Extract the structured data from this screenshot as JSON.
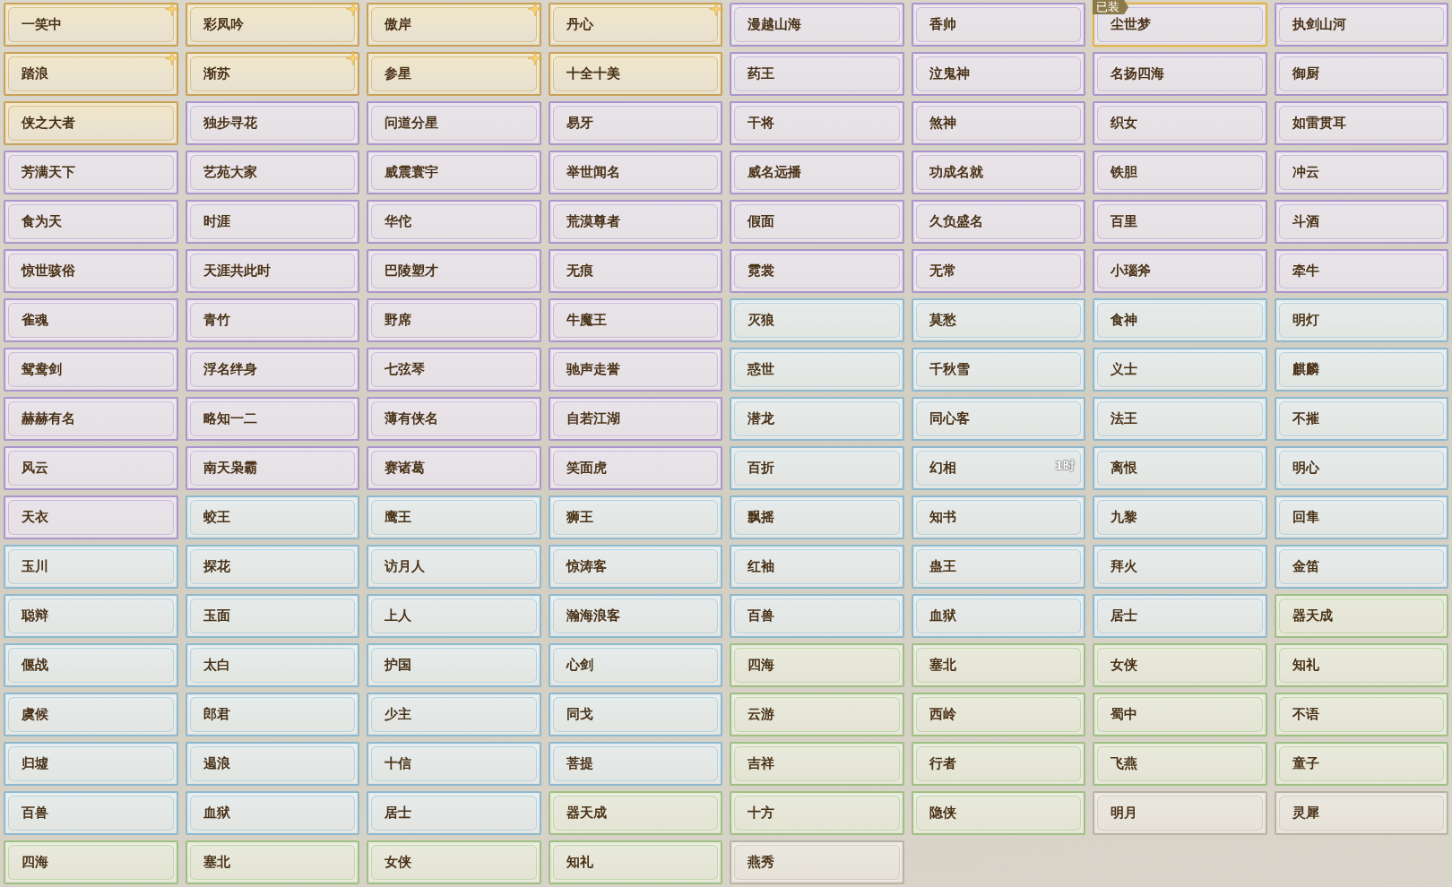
{
  "titles": [
    {
      "name": "一笑中",
      "kind": "gold",
      "starred": true,
      "equipped": false
    },
    {
      "name": "彩凤吟",
      "kind": "gold",
      "starred": true,
      "equipped": false
    },
    {
      "name": "傲岸",
      "kind": "gold",
      "starred": true,
      "equipped": false
    },
    {
      "name": "丹心",
      "kind": "gold",
      "starred": true,
      "equipped": false
    },
    {
      "name": "漫越山海",
      "kind": "purple",
      "starred": false,
      "equipped": false
    },
    {
      "name": "香帅",
      "kind": "purple",
      "starred": false,
      "equipped": false
    },
    {
      "name": "尘世梦",
      "kind": "purple",
      "starred": false,
      "equipped": true,
      "badge": "已装"
    },
    {
      "name": "执剑山河",
      "kind": "purple",
      "starred": false,
      "equipped": false
    },
    {
      "name": "踏浪",
      "kind": "gold",
      "starred": true,
      "equipped": false
    },
    {
      "name": "渐苏",
      "kind": "gold",
      "starred": true,
      "equipped": false
    },
    {
      "name": "参星",
      "kind": "gold",
      "starred": true,
      "equipped": false
    },
    {
      "name": "十全十美",
      "kind": "gold",
      "starred": false,
      "equipped": false
    },
    {
      "name": "药王",
      "kind": "purple",
      "starred": false,
      "equipped": false
    },
    {
      "name": "泣鬼神",
      "kind": "purple",
      "starred": false,
      "equipped": false
    },
    {
      "name": "名扬四海",
      "kind": "purple",
      "starred": false,
      "equipped": false
    },
    {
      "name": "御厨",
      "kind": "purple",
      "starred": false,
      "equipped": false
    },
    {
      "name": "侠之大者",
      "kind": "gold",
      "starred": false,
      "equipped": false
    },
    {
      "name": "独步寻花",
      "kind": "purple",
      "starred": false,
      "equipped": false
    },
    {
      "name": "问道分星",
      "kind": "purple",
      "starred": false,
      "equipped": false
    },
    {
      "name": "易牙",
      "kind": "purple",
      "starred": false,
      "equipped": false
    },
    {
      "name": "干将",
      "kind": "purple",
      "starred": false,
      "equipped": false
    },
    {
      "name": "煞神",
      "kind": "purple",
      "starred": false,
      "equipped": false
    },
    {
      "name": "织女",
      "kind": "purple",
      "starred": false,
      "equipped": false
    },
    {
      "name": "如雷贯耳",
      "kind": "purple",
      "starred": false,
      "equipped": false
    },
    {
      "name": "芳满天下",
      "kind": "purple",
      "starred": false,
      "equipped": false
    },
    {
      "name": "艺苑大家",
      "kind": "purple",
      "starred": false,
      "equipped": false
    },
    {
      "name": "威震寰宇",
      "kind": "purple",
      "starred": false,
      "equipped": false
    },
    {
      "name": "举世闻名",
      "kind": "purple",
      "starred": false,
      "equipped": false
    },
    {
      "name": "威名远播",
      "kind": "purple",
      "starred": false,
      "equipped": false
    },
    {
      "name": "功成名就",
      "kind": "purple",
      "starred": false,
      "equipped": false
    },
    {
      "name": "铁胆",
      "kind": "purple",
      "starred": false,
      "equipped": false
    },
    {
      "name": "冲云",
      "kind": "purple",
      "starred": false,
      "equipped": false
    },
    {
      "name": "食为天",
      "kind": "purple",
      "starred": false,
      "equipped": false
    },
    {
      "name": "时涯",
      "kind": "purple",
      "starred": false,
      "equipped": false
    },
    {
      "name": "华佗",
      "kind": "purple",
      "starred": false,
      "equipped": false
    },
    {
      "name": "荒漠尊者",
      "kind": "purple",
      "starred": false,
      "equipped": false
    },
    {
      "name": "假面",
      "kind": "purple",
      "starred": false,
      "equipped": false
    },
    {
      "name": "久负盛名",
      "kind": "purple",
      "starred": false,
      "equipped": false
    },
    {
      "name": "百里",
      "kind": "purple",
      "starred": false,
      "equipped": false
    },
    {
      "name": "斗酒",
      "kind": "purple",
      "starred": false,
      "equipped": false
    },
    {
      "name": "惊世骇俗",
      "kind": "purple",
      "starred": false,
      "equipped": false
    },
    {
      "name": "天涯共此时",
      "kind": "purple",
      "starred": false,
      "equipped": false
    },
    {
      "name": "巴陵塑才",
      "kind": "purple",
      "starred": false,
      "equipped": false
    },
    {
      "name": "无痕",
      "kind": "purple",
      "starred": false,
      "equipped": false
    },
    {
      "name": "霓裳",
      "kind": "purple",
      "starred": false,
      "equipped": false
    },
    {
      "name": "无常",
      "kind": "purple",
      "starred": false,
      "equipped": false
    },
    {
      "name": "小瑙斧",
      "kind": "purple",
      "starred": false,
      "equipped": false
    },
    {
      "name": "牵牛",
      "kind": "purple",
      "starred": false,
      "equipped": false
    },
    {
      "name": "雀魂",
      "kind": "purple",
      "starred": false,
      "equipped": false
    },
    {
      "name": "青竹",
      "kind": "purple",
      "starred": false,
      "equipped": false
    },
    {
      "name": "野席",
      "kind": "purple",
      "starred": false,
      "equipped": false
    },
    {
      "name": "牛魔王",
      "kind": "purple",
      "starred": false,
      "equipped": false
    },
    {
      "name": "灭狼",
      "kind": "blue",
      "starred": false,
      "equipped": false
    },
    {
      "name": "莫愁",
      "kind": "blue",
      "starred": false,
      "equipped": false
    },
    {
      "name": "食神",
      "kind": "blue",
      "starred": false,
      "equipped": false
    },
    {
      "name": "明灯",
      "kind": "blue",
      "starred": false,
      "equipped": false
    },
    {
      "name": "鸳鸯剑",
      "kind": "purple",
      "starred": false,
      "equipped": false
    },
    {
      "name": "浮名绊身",
      "kind": "purple",
      "starred": false,
      "equipped": false
    },
    {
      "name": "七弦琴",
      "kind": "purple",
      "starred": false,
      "equipped": false
    },
    {
      "name": "驰声走誉",
      "kind": "purple",
      "starred": false,
      "equipped": false
    },
    {
      "name": "惑世",
      "kind": "blue",
      "starred": false,
      "equipped": false
    },
    {
      "name": "千秋雪",
      "kind": "blue",
      "starred": false,
      "equipped": false
    },
    {
      "name": "义士",
      "kind": "blue",
      "starred": false,
      "equipped": false
    },
    {
      "name": "麒麟",
      "kind": "blue",
      "starred": false,
      "equipped": false
    },
    {
      "name": "赫赫有名",
      "kind": "purple",
      "starred": false,
      "equipped": false
    },
    {
      "name": "略知一二",
      "kind": "purple",
      "starred": false,
      "equipped": false
    },
    {
      "name": "薄有侠名",
      "kind": "purple",
      "starred": false,
      "equipped": false
    },
    {
      "name": "自若江湖",
      "kind": "purple",
      "starred": false,
      "equipped": false
    },
    {
      "name": "潜龙",
      "kind": "blue",
      "starred": false,
      "equipped": false
    },
    {
      "name": "同心客",
      "kind": "blue",
      "starred": false,
      "equipped": false
    },
    {
      "name": "法王",
      "kind": "blue",
      "starred": false,
      "equipped": false
    },
    {
      "name": "不摧",
      "kind": "blue",
      "starred": false,
      "equipped": false
    },
    {
      "name": "风云",
      "kind": "purple",
      "starred": false,
      "equipped": false
    },
    {
      "name": "南天枭霸",
      "kind": "purple",
      "starred": false,
      "equipped": false
    },
    {
      "name": "赛诸葛",
      "kind": "purple",
      "starred": false,
      "equipped": false
    },
    {
      "name": "笑面虎",
      "kind": "purple",
      "starred": false,
      "equipped": false
    },
    {
      "name": "百折",
      "kind": "blue",
      "starred": false,
      "equipped": false
    },
    {
      "name": "幻相",
      "kind": "blue",
      "starred": false,
      "equipped": false,
      "timer": "1时"
    },
    {
      "name": "离恨",
      "kind": "blue",
      "starred": false,
      "equipped": false
    },
    {
      "name": "明心",
      "kind": "blue",
      "starred": false,
      "equipped": false
    },
    {
      "name": "天衣",
      "kind": "purple",
      "starred": false,
      "equipped": false
    },
    {
      "name": "蛟王",
      "kind": "blue",
      "starred": false,
      "equipped": false
    },
    {
      "name": "鹰王",
      "kind": "blue",
      "starred": false,
      "equipped": false
    },
    {
      "name": "狮王",
      "kind": "blue",
      "starred": false,
      "equipped": false
    },
    {
      "name": "飘摇",
      "kind": "blue",
      "starred": false,
      "equipped": false
    },
    {
      "name": "知书",
      "kind": "blue",
      "starred": false,
      "equipped": false
    },
    {
      "name": "九黎",
      "kind": "blue",
      "starred": false,
      "equipped": false
    },
    {
      "name": "回隼",
      "kind": "blue",
      "starred": false,
      "equipped": false
    },
    {
      "name": "玉川",
      "kind": "blue",
      "starred": false,
      "equipped": false
    },
    {
      "name": "探花",
      "kind": "blue",
      "starred": false,
      "equipped": false
    },
    {
      "name": "访月人",
      "kind": "blue",
      "starred": false,
      "equipped": false
    },
    {
      "name": "惊涛客",
      "kind": "blue",
      "starred": false,
      "equipped": false
    },
    {
      "name": "红袖",
      "kind": "blue",
      "starred": false,
      "equipped": false
    },
    {
      "name": "蛊王",
      "kind": "blue",
      "starred": false,
      "equipped": false
    },
    {
      "name": "拜火",
      "kind": "blue",
      "starred": false,
      "equipped": false
    },
    {
      "name": "金笛",
      "kind": "blue",
      "starred": false,
      "equipped": false
    },
    {
      "name": "聪辩",
      "kind": "blue",
      "starred": false,
      "equipped": false
    },
    {
      "name": "玉面",
      "kind": "blue",
      "starred": false,
      "equipped": false
    },
    {
      "name": "上人",
      "kind": "blue",
      "starred": false,
      "equipped": false
    },
    {
      "name": "瀚海浪客",
      "kind": "blue",
      "starred": false,
      "equipped": false
    },
    {
      "name": "百兽",
      "kind": "blue",
      "starred": false,
      "equipped": false
    },
    {
      "name": "血狱",
      "kind": "blue",
      "starred": false,
      "equipped": false
    },
    {
      "name": "居士",
      "kind": "blue",
      "starred": false,
      "equipped": false
    },
    {
      "name": "器天成",
      "kind": "green",
      "starred": false,
      "equipped": false
    },
    {
      "name": "偃战",
      "kind": "blue",
      "starred": false,
      "equipped": false
    },
    {
      "name": "太白",
      "kind": "blue",
      "starred": false,
      "equipped": false
    },
    {
      "name": "护国",
      "kind": "blue",
      "starred": false,
      "equipped": false
    },
    {
      "name": "心剑",
      "kind": "blue",
      "starred": false,
      "equipped": false
    },
    {
      "name": "四海",
      "kind": "green",
      "starred": false,
      "equipped": false
    },
    {
      "name": "塞北",
      "kind": "green",
      "starred": false,
      "equipped": false
    },
    {
      "name": "女侠",
      "kind": "green",
      "starred": false,
      "equipped": false
    },
    {
      "name": "知礼",
      "kind": "green",
      "starred": false,
      "equipped": false
    },
    {
      "name": "虞候",
      "kind": "blue",
      "starred": false,
      "equipped": false
    },
    {
      "name": "郎君",
      "kind": "blue",
      "starred": false,
      "equipped": false
    },
    {
      "name": "少主",
      "kind": "blue",
      "starred": false,
      "equipped": false
    },
    {
      "name": "同戈",
      "kind": "blue",
      "starred": false,
      "equipped": false
    },
    {
      "name": "云游",
      "kind": "green",
      "starred": false,
      "equipped": false
    },
    {
      "name": "西岭",
      "kind": "green",
      "starred": false,
      "equipped": false
    },
    {
      "name": "蜀中",
      "kind": "green",
      "starred": false,
      "equipped": false
    },
    {
      "name": "不语",
      "kind": "green",
      "starred": false,
      "equipped": false
    },
    {
      "name": "归墟",
      "kind": "blue",
      "starred": false,
      "equipped": false
    },
    {
      "name": "遏浪",
      "kind": "blue",
      "starred": false,
      "equipped": false
    },
    {
      "name": "十信",
      "kind": "blue",
      "starred": false,
      "equipped": false
    },
    {
      "name": "菩提",
      "kind": "blue",
      "starred": false,
      "equipped": false
    },
    {
      "name": "吉祥",
      "kind": "green",
      "starred": false,
      "equipped": false
    },
    {
      "name": "行者",
      "kind": "green",
      "starred": false,
      "equipped": false
    },
    {
      "name": "飞燕",
      "kind": "green",
      "starred": false,
      "equipped": false
    },
    {
      "name": "童子",
      "kind": "green",
      "starred": false,
      "equipped": false
    },
    {
      "name": "百兽",
      "kind": "blue",
      "starred": false,
      "equipped": false
    },
    {
      "name": "血狱",
      "kind": "blue",
      "starred": false,
      "equipped": false
    },
    {
      "name": "居士",
      "kind": "blue",
      "starred": false,
      "equipped": false
    },
    {
      "name": "器天成",
      "kind": "green",
      "starred": false,
      "equipped": false
    },
    {
      "name": "十方",
      "kind": "green",
      "starred": false,
      "equipped": false
    },
    {
      "name": "隐侠",
      "kind": "green",
      "starred": false,
      "equipped": false
    },
    {
      "name": "明月",
      "kind": "grey",
      "starred": false,
      "equipped": false
    },
    {
      "name": "灵犀",
      "kind": "grey",
      "starred": false,
      "equipped": false
    },
    {
      "name": "四海",
      "kind": "green",
      "starred": false,
      "equipped": false
    },
    {
      "name": "塞北",
      "kind": "green",
      "starred": false,
      "equipped": false
    },
    {
      "name": "女侠",
      "kind": "green",
      "starred": false,
      "equipped": false
    },
    {
      "name": "知礼",
      "kind": "green",
      "starred": false,
      "equipped": false
    },
    {
      "name": "燕秀",
      "kind": "grey",
      "starred": false,
      "equipped": false
    }
  ]
}
